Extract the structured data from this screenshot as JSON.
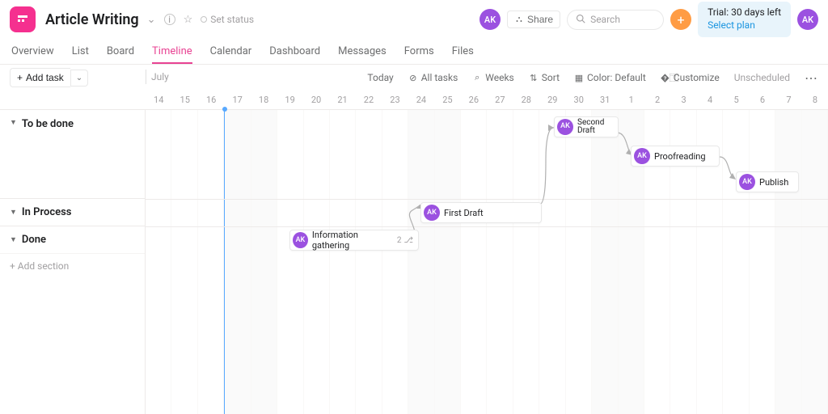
{
  "project": {
    "title": "Article Writing",
    "set_status": "Set status"
  },
  "user_initials": "AK",
  "share_label": "Share",
  "search_placeholder": "Search",
  "trial": {
    "line1": "Trial: 30 days left",
    "line2": "Select plan"
  },
  "tabs": [
    "Overview",
    "List",
    "Board",
    "Timeline",
    "Calendar",
    "Dashboard",
    "Messages",
    "Forms",
    "Files"
  ],
  "active_tab": "Timeline",
  "add_task_label": "Add task",
  "month_label": "July",
  "toolbar_right": {
    "today": "Today",
    "all_tasks": "All tasks",
    "weeks": "Weeks",
    "sort": "Sort",
    "color": "Color: Default",
    "customize": "Customize",
    "unscheduled": "Unscheduled"
  },
  "days": [
    {
      "n": "14",
      "w": false
    },
    {
      "n": "15",
      "w": false
    },
    {
      "n": "16",
      "w": false
    },
    {
      "n": "17",
      "w": true,
      "today": true
    },
    {
      "n": "18",
      "w": true
    },
    {
      "n": "19",
      "w": false
    },
    {
      "n": "20",
      "w": false
    },
    {
      "n": "21",
      "w": false
    },
    {
      "n": "22",
      "w": false
    },
    {
      "n": "23",
      "w": false
    },
    {
      "n": "24",
      "w": true
    },
    {
      "n": "25",
      "w": true
    },
    {
      "n": "26",
      "w": false
    },
    {
      "n": "27",
      "w": false
    },
    {
      "n": "28",
      "w": false
    },
    {
      "n": "29",
      "w": false
    },
    {
      "n": "30",
      "w": false
    },
    {
      "n": "31",
      "w": true
    },
    {
      "n": "1",
      "w": true
    },
    {
      "n": "2",
      "w": false
    },
    {
      "n": "3",
      "w": false
    },
    {
      "n": "4",
      "w": false
    },
    {
      "n": "5",
      "w": false
    },
    {
      "n": "6",
      "w": false
    },
    {
      "n": "7",
      "w": true
    },
    {
      "n": "8",
      "w": true
    }
  ],
  "sections": {
    "to_be_done": "To be done",
    "in_process": "In Process",
    "done": "Done",
    "add_section": "+ Add section"
  },
  "tasks": {
    "second_draft": "Second\nDraft",
    "proofreading": "Proofreading",
    "publish": "Publish",
    "first_draft": "First Draft",
    "info_gathering": "Information gathering",
    "info_subtasks": "2"
  }
}
